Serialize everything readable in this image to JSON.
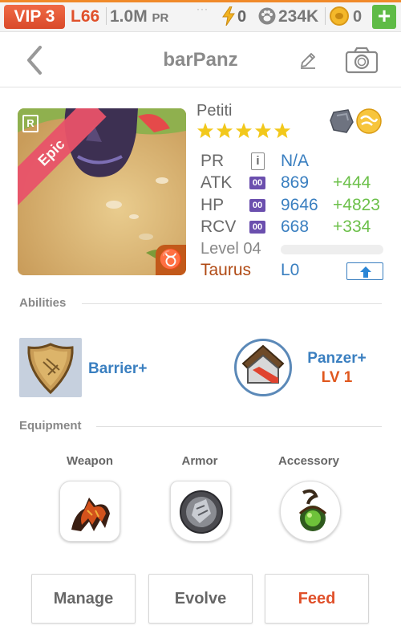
{
  "status_bar": {
    "vip": "VIP 3",
    "level": "L66",
    "pr_value": "1.0M",
    "pr_unit": "PR",
    "energy": "0",
    "paws": "234K",
    "coins": "0",
    "add_label": "+"
  },
  "header": {
    "title": "barPanz"
  },
  "monster": {
    "name": "Petiti",
    "rarity": "Epic",
    "stars": 5,
    "stats": [
      {
        "label": "PR",
        "badge": "i",
        "value": "N/A",
        "bonus": ""
      },
      {
        "label": "ATK",
        "badge": "00",
        "value": "869",
        "bonus": "+444"
      },
      {
        "label": "HP",
        "badge": "00",
        "value": "9646",
        "bonus": "+4823"
      },
      {
        "label": "RCV",
        "badge": "00",
        "value": "668",
        "bonus": "+334"
      }
    ],
    "level_label": "Level 04",
    "sign": "Taurus",
    "sign_level": "L0",
    "colors": {
      "stat_value": "#3a7fc0",
      "bonus": "#6cc04a",
      "sign": "#b04a14"
    }
  },
  "abilities": {
    "header": "Abilities",
    "items": [
      {
        "name": "Barrier+",
        "level": ""
      },
      {
        "name": "Panzer+",
        "level": "LV 1"
      }
    ]
  },
  "equipment": {
    "header": "Equipment",
    "slots": [
      {
        "label": "Weapon"
      },
      {
        "label": "Armor"
      },
      {
        "label": "Accessory"
      }
    ]
  },
  "actions": {
    "manage": "Manage",
    "evolve": "Evolve",
    "feed": "Feed"
  }
}
